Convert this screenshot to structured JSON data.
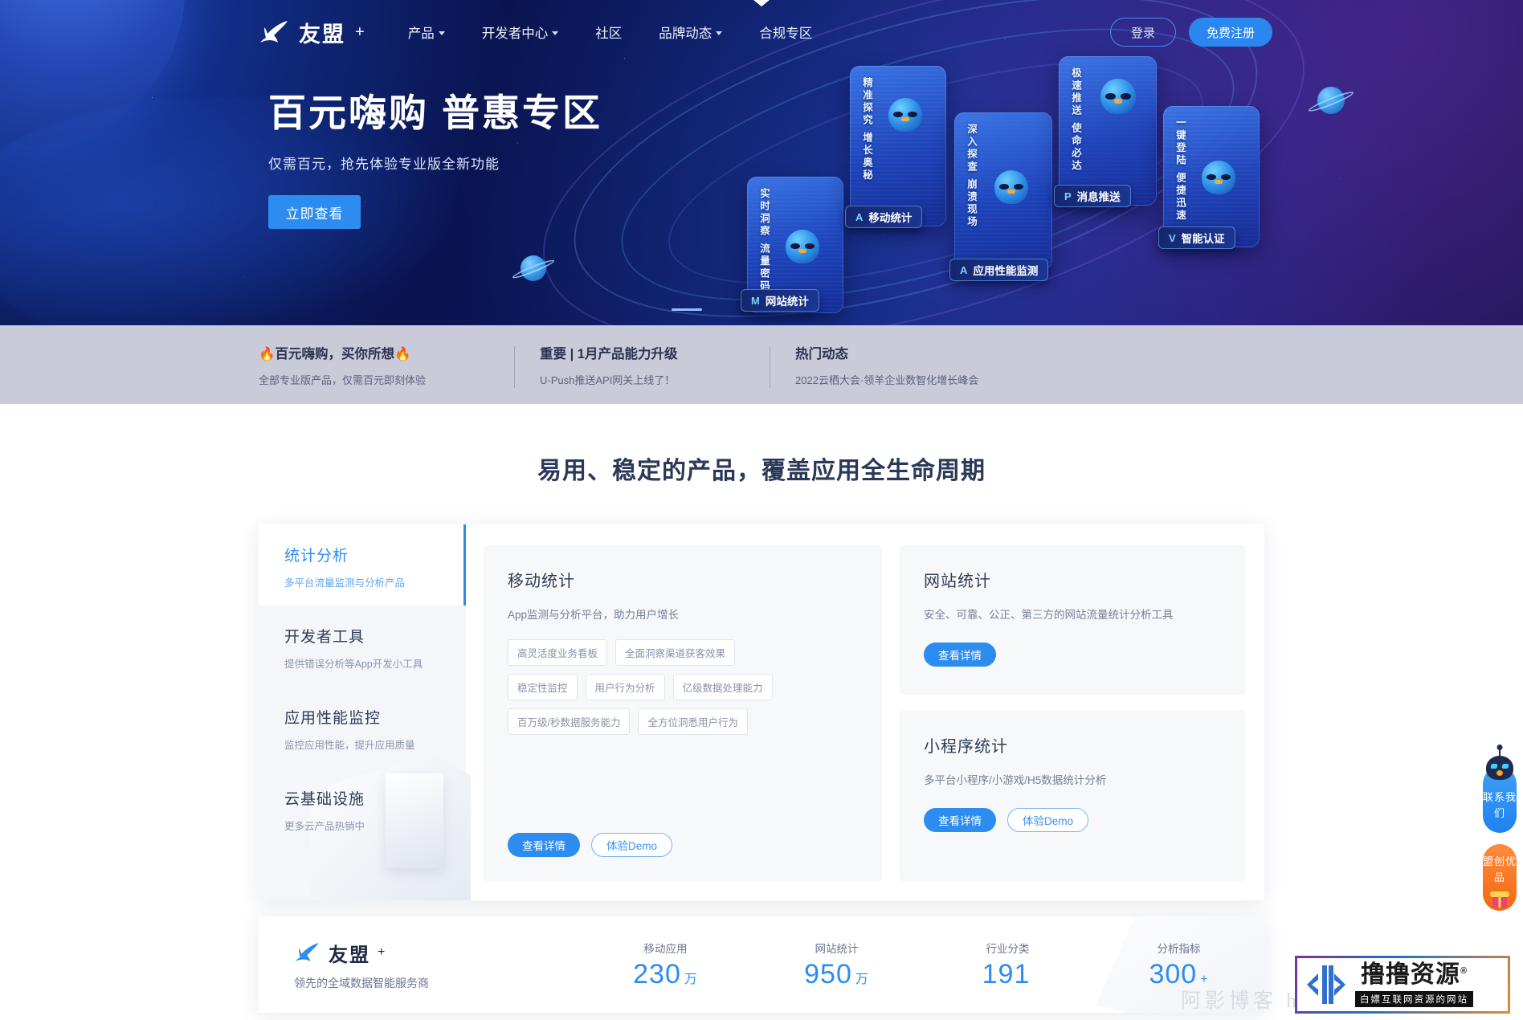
{
  "nav": {
    "logo_text": "友盟",
    "logo_plus": "+",
    "items": [
      {
        "label": "产品",
        "has_caret": true
      },
      {
        "label": "开发者中心",
        "has_caret": true
      },
      {
        "label": "社区",
        "has_caret": false
      },
      {
        "label": "品牌动态",
        "has_caret": true
      },
      {
        "label": "合规专区",
        "has_caret": false
      }
    ],
    "login": "登录",
    "register": "免费注册"
  },
  "hero": {
    "title": "百元嗨购 普惠专区",
    "subtitle": "仅需百元，抢先体验专业版全新功能",
    "cta": "立即查看",
    "cards": [
      {
        "vtext": "实时洞察 流量密码",
        "label": "网站统计",
        "glyph": "M"
      },
      {
        "vtext": "精准探究 增长奥秘",
        "label": "移动统计",
        "glyph": "A"
      },
      {
        "vtext": "深入探查 崩溃现场",
        "label": "应用性能监测",
        "glyph": "A"
      },
      {
        "vtext": "极速推送 使命必达",
        "label": "消息推送",
        "glyph": "P"
      },
      {
        "vtext": "一键登陆 便捷迅速",
        "label": "智能认证",
        "glyph": "V"
      }
    ]
  },
  "notice": [
    {
      "title": "🔥百元嗨购，买你所想🔥",
      "sub": "全部专业版产品，仅需百元即刻体验"
    },
    {
      "title": "重要 | 1月产品能力升级",
      "sub": "U-Push推送API网关上线了！"
    },
    {
      "title": "热门动态",
      "sub": "2022云栖大会·领羊企业数智化增长峰会"
    }
  ],
  "section": {
    "title": "易用、稳定的产品，覆盖应用全生命周期",
    "tabs": [
      {
        "title": "统计分析",
        "sub": "多平台流量监测与分析产品",
        "active": true
      },
      {
        "title": "开发者工具",
        "sub": "提供错误分析等App开发小工具",
        "active": false
      },
      {
        "title": "应用性能监控",
        "sub": "监控应用性能，提升应用质量",
        "active": false
      },
      {
        "title": "云基础设施",
        "sub": "更多云产品热销中",
        "active": false
      }
    ],
    "main_card": {
      "title": "移动统计",
      "desc": "App监测与分析平台，助力用户增长",
      "tags": [
        "高灵活度业务看板",
        "全面洞察渠道获客效果",
        "稳定性监控",
        "用户行为分析",
        "亿级数据处理能力",
        "百万级/秒数据服务能力",
        "全方位洞悉用户行为"
      ],
      "btn_primary": "查看详情",
      "btn_ghost": "体验Demo"
    },
    "side_cards": [
      {
        "title": "网站统计",
        "desc": "安全、可靠、公正、第三方的网站流量统计分析工具",
        "btn_primary": "查看详情",
        "btn_ghost": ""
      },
      {
        "title": "小程序统计",
        "desc": "多平台小程序/小游戏/H5数据统计分析",
        "btn_primary": "查看详情",
        "btn_ghost": "体验Demo"
      }
    ]
  },
  "stats": {
    "brand_name": "友盟",
    "brand_plus": "+",
    "brand_sub": "领先的全域数据智能服务商",
    "items": [
      {
        "label": "移动应用",
        "value": "230",
        "unit": "万"
      },
      {
        "label": "网站统计",
        "value": "950",
        "unit": "万"
      },
      {
        "label": "行业分类",
        "value": "191",
        "unit": ""
      },
      {
        "label": "分析指标",
        "value": "300",
        "unit": "+"
      }
    ]
  },
  "floats": [
    {
      "name": "contact",
      "text": "联系我们"
    },
    {
      "name": "goods",
      "text": "盟创优品"
    }
  ],
  "watermark": {
    "background_text": "阿影博客 htt",
    "main": "撸撸资源",
    "reg": "®",
    "tagline": "白嫖互联网资源的网站"
  },
  "colors": {
    "accent_blue": "#2d8cf0",
    "hero_bg": "#0a1553",
    "notice_bg": "#c9cbd8",
    "orange": "#f2690f"
  }
}
